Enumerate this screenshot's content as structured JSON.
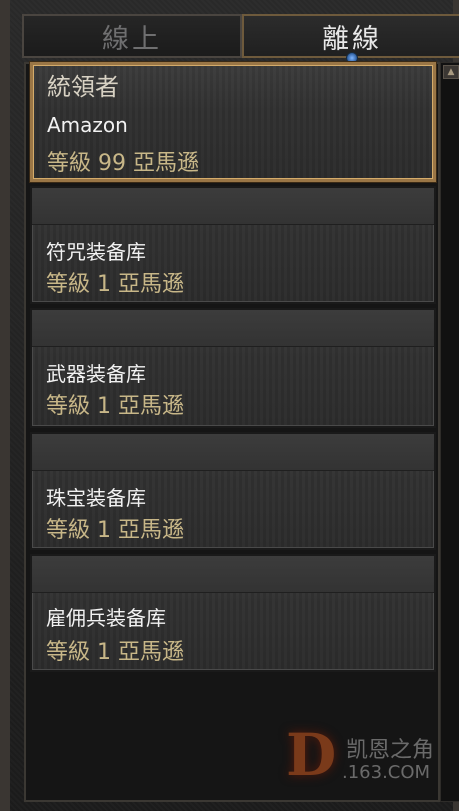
{
  "tabs": [
    {
      "label": "線上",
      "state": "inactive"
    },
    {
      "label": "離線",
      "state": "active"
    }
  ],
  "roster": {
    "group_title": "統領者",
    "characters": [
      {
        "name": "Amazon",
        "level": "等級 99 亞馬遜",
        "selected": true
      },
      {
        "name": "符咒装备库",
        "level": "等級 1 亞馬遜",
        "selected": false
      },
      {
        "name": "武器装备库",
        "level": "等級 1 亞馬遜",
        "selected": false
      },
      {
        "name": "珠宝装备库",
        "level": "等級 1 亞馬遜",
        "selected": false
      },
      {
        "name": "雇佣兵装备库",
        "level": "等級 1 亞馬遜",
        "selected": false
      }
    ]
  },
  "watermark": {
    "logo_letter": "D",
    "line1": "凯恩之角",
    "line2": ".163.COM"
  },
  "colors": {
    "selected_border": "#9a7646",
    "level_text": "#c8b788",
    "name_text": "#f2f2f2"
  }
}
